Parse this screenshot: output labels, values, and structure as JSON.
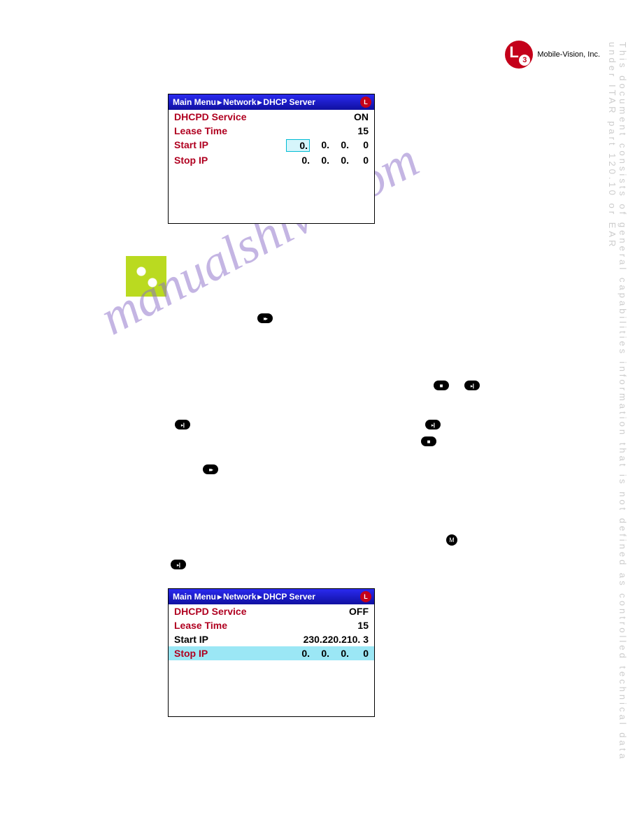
{
  "logo": {
    "text": "Mobile-Vision, Inc."
  },
  "side_text": "This document consists of general capabilities information that is not defined as controlled technical data under  ITAR part 120.10 or EAR",
  "box1": {
    "header_parts": [
      "Main Menu",
      "Network",
      "DHCP Server"
    ],
    "rows": [
      {
        "label": "DHCPD Service",
        "value": "ON"
      },
      {
        "label": "Lease Time",
        "value": "15"
      }
    ],
    "start_ip_label": "Start IP",
    "start_ip": [
      "0.",
      "0.",
      "0.",
      "0"
    ],
    "stop_ip_label": "Stop IP",
    "stop_ip": [
      "0.",
      "0.",
      "0.",
      "0"
    ]
  },
  "box2": {
    "header_parts": [
      "Main Menu",
      "Network",
      "DHCP Server"
    ],
    "rows": [
      {
        "label": "DHCPD Service",
        "value": "OFF"
      },
      {
        "label": "Lease Time",
        "value": "15"
      },
      {
        "label": "Start IP",
        "value": "230.220.210.   3"
      }
    ],
    "stop_ip_label": "Stop IP",
    "stop_ip": [
      "0.",
      "0.",
      "0.",
      "0"
    ]
  },
  "watermark": "manualshive.com"
}
